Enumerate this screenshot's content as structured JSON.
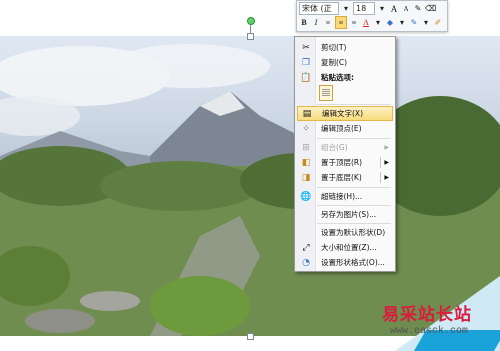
{
  "mini_toolbar": {
    "font_name": "宋体 (正",
    "font_size": "18",
    "grow_font": "A",
    "shrink_font": "A",
    "bold": "B",
    "italic": "I",
    "font_color_letter": "A"
  },
  "context_menu": {
    "items": [
      {
        "label": "剪切(T)",
        "icon": "scissors-icon",
        "enabled": true
      },
      {
        "label": "复制(C)",
        "icon": "copy-icon",
        "enabled": true
      },
      {
        "label": "粘贴选项:",
        "icon": "paste-icon",
        "enabled": true
      },
      {
        "label": "编辑文字(X)",
        "icon": "edit-text-icon",
        "enabled": true,
        "highlighted": true
      },
      {
        "label": "编辑顶点(E)",
        "icon": "edit-points-icon",
        "enabled": true
      },
      {
        "label": "组合(G)",
        "icon": "group-icon",
        "enabled": false
      },
      {
        "label": "置于顶层(R)",
        "icon": "bring-front-icon",
        "enabled": true
      },
      {
        "label": "置于底层(K)",
        "icon": "send-back-icon",
        "enabled": true
      },
      {
        "label": "超链接(H)...",
        "icon": "hyperlink-icon",
        "enabled": true
      },
      {
        "label": "另存为图片(S)...",
        "icon": "",
        "enabled": true
      },
      {
        "label": "设置为默认形状(D)",
        "icon": "",
        "enabled": true
      },
      {
        "label": "大小和位置(Z)...",
        "icon": "size-position-icon",
        "enabled": true
      },
      {
        "label": "设置形状格式(O)...",
        "icon": "format-shape-icon",
        "enabled": true
      }
    ]
  },
  "watermark": {
    "site_name": "易采站长站",
    "url": "www.easck.com"
  },
  "colors": {
    "highlight": "#f8dc7e",
    "watermark_red": "#d91c3c",
    "watermark_blue": "#1aa3d8"
  }
}
